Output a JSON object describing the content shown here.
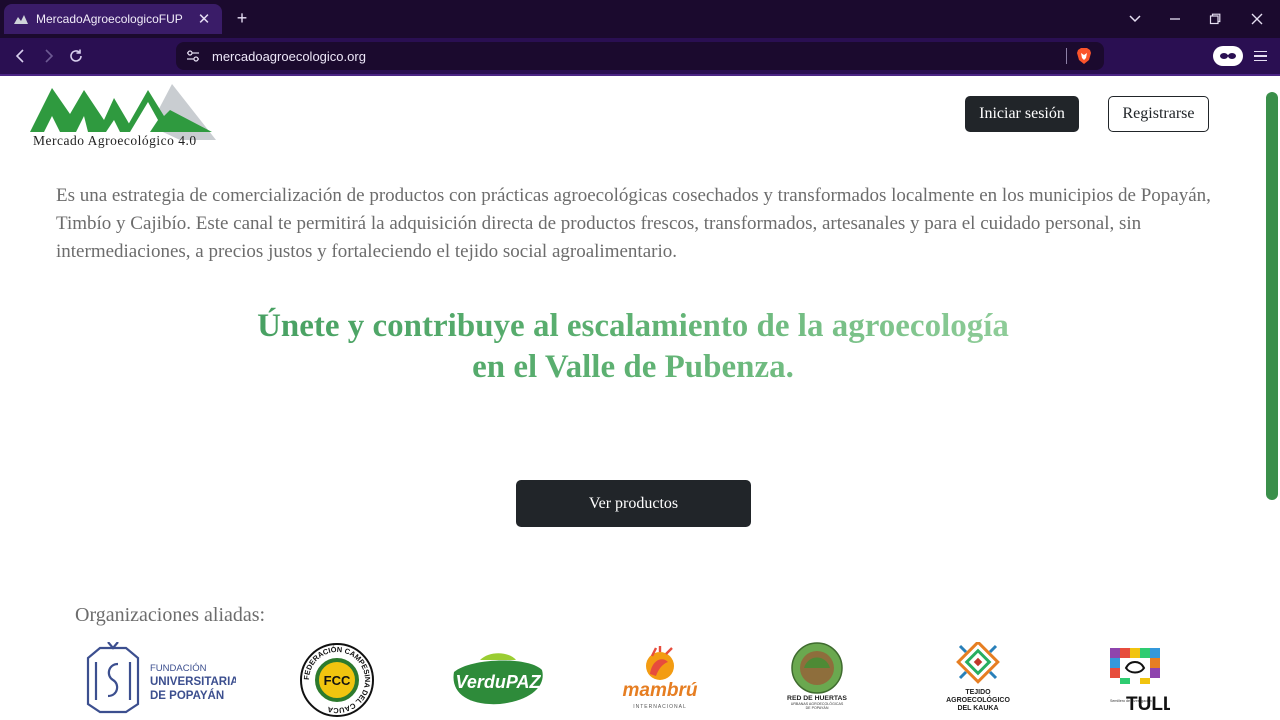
{
  "browser": {
    "tab_title": "MercadoAgroecologicoFUP",
    "tab_close": "✕",
    "new_tab": "+",
    "url": "mercadoagroecologico.org"
  },
  "header": {
    "logo_text": "Mercado Agroecológico 4.0",
    "login_label": "Iniciar sesión",
    "register_label": "Registrarse"
  },
  "main": {
    "intro": "Es una estrategia de comercialización de productos con prácticas agroecológicas cosechados y transformados localmente en los municipios de Popayán, Timbío y Cajibío. Este canal te permitirá la adquisición directa de productos frescos, transformados, artesanales y para el cuidado personal, sin intermediaciones, a precios justos y fortaleciendo el tejido social agroalimentario.",
    "headline_line1": "Únete y contribuye al escalamiento de la agroecología",
    "headline_line2": "en el Valle de Pubenza.",
    "products_button": "Ver productos"
  },
  "allies": {
    "title": "Organizaciones aliadas:",
    "fup_line1": "FUNDACIÓN",
    "fup_line2": "UNIVERSITARIA",
    "fup_line3": "DE POPAYÁN",
    "fcc_center": "FCC",
    "fcc_ring": "FEDERACIÓN CAMPESINA DEL CAUCA",
    "verdupaz": "VerduPAZ",
    "mambru": "mambrú",
    "mambru_sub": "INTERNACIONAL",
    "huertas_line1": "RED DE HUERTAS",
    "huertas_line2": "URBANAS AGROECOLÓGICAS",
    "huertas_line3": "DE POPAYÁN",
    "tejido_line1": "TEJIDO",
    "tejido_line2": "AGROECOLÓGICO",
    "tejido_line3": "DEL KAUKA",
    "tull": "TULL",
    "tull_sub": "Semillero de investigación"
  },
  "colors": {
    "chrome_dark": "#1b0a2e",
    "chrome_toolbar": "#2a0f52",
    "primary_button": "#212529",
    "headline_green": "#3f9a5c",
    "logo_green": "#2f9a3f",
    "scroll_green": "#3a8f4a"
  }
}
